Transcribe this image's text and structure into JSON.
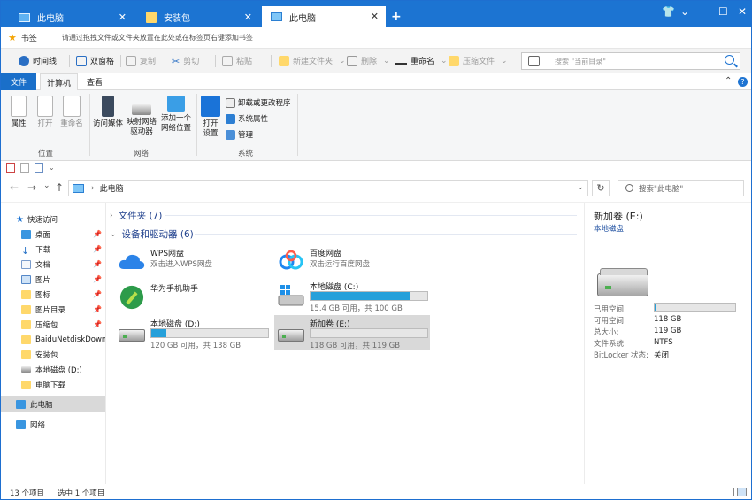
{
  "tabs": [
    {
      "label": "此电脑"
    },
    {
      "label": "安装包"
    },
    {
      "label": "此电脑"
    }
  ],
  "window_controls": [
    "shirt-icon",
    "minimize",
    "maximize",
    "close"
  ],
  "bookmarks": {
    "label": "书签",
    "hint": "请通过拖拽文件或文件夹放置在此处或在标签页右键添加书签"
  },
  "toolbar": {
    "timeline": "时间线",
    "dual_pane": "双窗格",
    "copy": "复制",
    "cut": "剪切",
    "paste": "粘贴",
    "new_folder": "新建文件夹",
    "delete": "删除",
    "rename": "重命名",
    "compress": "压缩文件",
    "search_placeholder": "搜索 \"当前目录\""
  },
  "ribbon_tabs": {
    "file": "文件",
    "computer": "计算机",
    "view": "查看"
  },
  "ribbon": {
    "properties": "属性",
    "open": "打开",
    "rename": "重命名",
    "location_group": "位置",
    "access_media": "访问媒体",
    "map_drive_1": "映射网络",
    "map_drive_2": "驱动器",
    "add_location_1": "添加一个",
    "add_location_2": "网络位置",
    "network_group": "网络",
    "open_settings_1": "打开",
    "open_settings_2": "设置",
    "uninstall": "卸载或更改程序",
    "sys_props": "系统属性",
    "manage": "管理",
    "system_group": "系统"
  },
  "address": {
    "path": "此电脑",
    "search_placeholder": "搜索\"此电脑\""
  },
  "nav": {
    "quick_access": "快速访问",
    "items": [
      {
        "label": "桌面"
      },
      {
        "label": "下载"
      },
      {
        "label": "文档"
      },
      {
        "label": "图片"
      },
      {
        "label": "图标"
      },
      {
        "label": "图片目录"
      },
      {
        "label": "压缩包"
      },
      {
        "label": "BaiduNetdiskDownload"
      },
      {
        "label": "安装包"
      },
      {
        "label": "本地磁盘 (D:)"
      },
      {
        "label": "电脑下载"
      }
    ],
    "this_pc": "此电脑",
    "network": "网络"
  },
  "content": {
    "folders_group": "文件夹 (7)",
    "devices_group": "设备和驱动器 (6)",
    "drives": [
      {
        "name": "WPS网盘",
        "sub": "双击进入WPS网盘"
      },
      {
        "name": "百度网盘",
        "sub": "双击运行百度网盘"
      },
      {
        "name": "华为手机助手",
        "sub": ""
      },
      {
        "name": "本地磁盘 (C:)",
        "sub": "15.4 GB 可用，共 100 GB",
        "used_percent": 84.6
      },
      {
        "name": "本地磁盘 (D:)",
        "sub": "120 GB 可用，共 138 GB",
        "used_percent": 13.0
      },
      {
        "name": "新加卷 (E:)",
        "sub": "118 GB 可用，共 119 GB",
        "used_percent": 0.8
      }
    ]
  },
  "details": {
    "title": "新加卷 (E:)",
    "subtitle": "本地磁盘",
    "used_label": "已用空间:",
    "used_percent": 0.8,
    "free_label": "可用空间:",
    "free_value": "118 GB",
    "total_label": "总大小:",
    "total_value": "119 GB",
    "fs_label": "文件系统:",
    "fs_value": "NTFS",
    "bitlocker_label": "BitLocker 状态:",
    "bitlocker_value": "关闭"
  },
  "status": {
    "count": "13 个项目",
    "selected": "选中 1 个项目"
  },
  "colors": {
    "accent": "#1c74d2",
    "bar_fill": "#26a0da",
    "selection": "#d9d9d9"
  }
}
